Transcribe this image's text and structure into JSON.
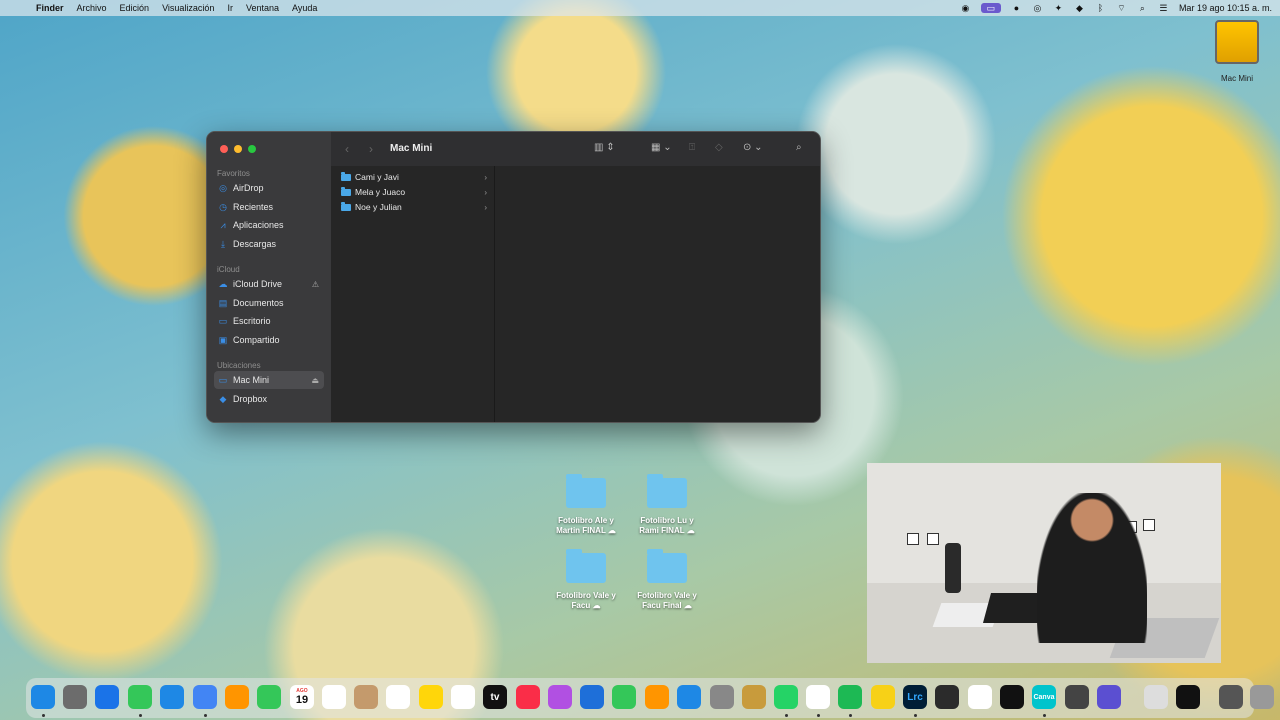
{
  "menubar": {
    "apple": "",
    "items": [
      "Finder",
      "Archivo",
      "Edición",
      "Visualización",
      "Ir",
      "Ventana",
      "Ayuda"
    ],
    "datetime": "Mar 19 ago  10:15 a. m."
  },
  "desktop_disk": {
    "label": "Mac Mini"
  },
  "window": {
    "title": "Mac Mini",
    "sidebar": {
      "favoritos_header": "Favoritos",
      "favoritos": [
        "AirDrop",
        "Recientes",
        "Aplicaciones",
        "Descargas"
      ],
      "icloud_header": "iCloud",
      "icloud": [
        "iCloud Drive",
        "Documentos",
        "Escritorio",
        "Compartido"
      ],
      "ubicaciones_header": "Ubicaciones",
      "ubicaciones": [
        "Mac Mini",
        "Dropbox"
      ]
    },
    "folders": [
      "Cami y Javi",
      "Mela y Juaco",
      "Noe y Julian"
    ]
  },
  "desktop_folders": [
    {
      "line1": "Fotolibro Ale y",
      "line2": "Martin FINAL ☁"
    },
    {
      "line1": "Fotolibro Lu y",
      "line2": "Rami FINAL ☁"
    },
    {
      "line1": "Fotolibro Vale y",
      "line2": "Facu ☁"
    },
    {
      "line1": "Fotolibro Vale y",
      "line2": "Facu Final ☁"
    }
  ],
  "dock": {
    "calendar_month": "AGO",
    "calendar_day": "19",
    "tv_label": "tv",
    "lrc_label": "Lrc",
    "canva_label": "Canva",
    "colors": [
      "#1e88e5",
      "#6c6c6c",
      "#1a73e8",
      "#34c759",
      "#1e88e5",
      "#4285f4",
      "#ff9500",
      "#34c759",
      "#ffffff",
      "#ffffff",
      "#c49a6c",
      "#ffffff",
      "#ffd60a",
      "#ffffff",
      "#111111",
      "#fa2d48",
      "#b150e2",
      "#1e6fd9",
      "#34c759",
      "#ff9500",
      "#1e88e5",
      "#888888",
      "#c89b3c",
      "#25d366",
      "#ffffff",
      "#1db954",
      "#f7d117",
      "#001e36",
      "#2b2b2b",
      "#ffffff",
      "#111111",
      "#00c4cc",
      "#444444",
      "#5b4fd1",
      "#dddddd",
      "#111111",
      "#555555",
      "#999999"
    ]
  }
}
